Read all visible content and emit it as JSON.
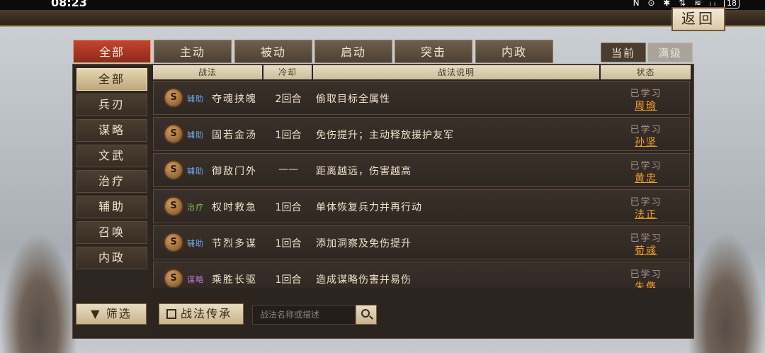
{
  "status_bar": {
    "time": "08:23",
    "icons_text": "N ⊙ ✱ ⇅ ≋ ᵢᵢ",
    "battery": "18"
  },
  "header": {
    "back_label": "返回"
  },
  "tabs": [
    {
      "label": "全部"
    },
    {
      "label": "主动"
    },
    {
      "label": "被动"
    },
    {
      "label": "启动"
    },
    {
      "label": "突击"
    },
    {
      "label": "内政"
    }
  ],
  "level_toggle": {
    "current": "当前",
    "max": "满级"
  },
  "sidebar": {
    "items": [
      {
        "label": "全部"
      },
      {
        "label": "兵刃"
      },
      {
        "label": "谋略"
      },
      {
        "label": "文武"
      },
      {
        "label": "治疗"
      },
      {
        "label": "辅助"
      },
      {
        "label": "召唤"
      },
      {
        "label": "内政"
      }
    ],
    "filter_label": "筛选"
  },
  "table": {
    "headers": {
      "skill": "战法",
      "cooldown": "冷却",
      "description": "战法说明",
      "status": "状态"
    },
    "rows": [
      {
        "badge": "S",
        "tag": "辅助",
        "tag_color": "#6fa6e8",
        "name": "夺魂挟魄",
        "cooldown": "2回合",
        "description": "偷取目标全属性",
        "status": "已学习",
        "general": "周瑜"
      },
      {
        "badge": "S",
        "tag": "辅助",
        "tag_color": "#6fa6e8",
        "name": "固若金汤",
        "cooldown": "1回合",
        "description": "免伤提升；主动释放援护友军",
        "status": "已学习",
        "general": "孙坚"
      },
      {
        "badge": "S",
        "tag": "辅助",
        "tag_color": "#6fa6e8",
        "name": "御敌门外",
        "cooldown": "——",
        "description": "距离越远，伤害越高",
        "status": "已学习",
        "general": "黄忠"
      },
      {
        "badge": "S",
        "tag": "治疗",
        "tag_color": "#7cc25a",
        "name": "权时救急",
        "cooldown": "1回合",
        "description": "单体恢复兵力并再行动",
        "status": "已学习",
        "general": "法正"
      },
      {
        "badge": "S",
        "tag": "辅助",
        "tag_color": "#6fa6e8",
        "name": "节烈多谋",
        "cooldown": "1回合",
        "description": "添加洞察及免伤提升",
        "status": "已学习",
        "general": "荀彧"
      },
      {
        "badge": "S",
        "tag": "谋略",
        "tag_color": "#c07ad8",
        "name": "乘胜长驱",
        "cooldown": "1回合",
        "description": "造成谋略伤害并易伤",
        "status": "已学习",
        "general": "朱儁"
      }
    ]
  },
  "bottom": {
    "inherit_label": "战法传承",
    "search_placeholder": "战法名称或描述"
  }
}
